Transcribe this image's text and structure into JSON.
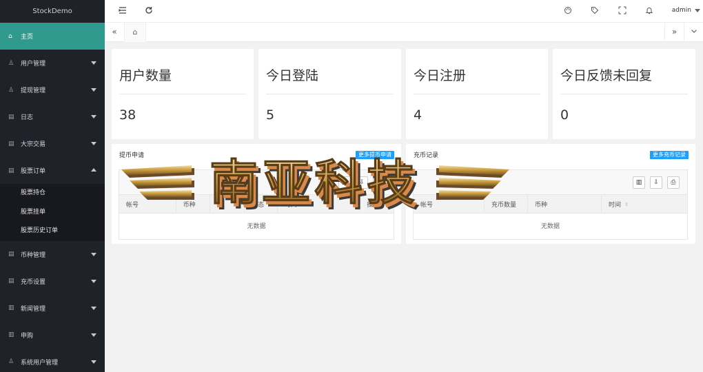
{
  "app": {
    "logo": "StockDemo"
  },
  "sidebar": {
    "items": [
      {
        "label": "主页",
        "icon": "home-icon",
        "active": true
      },
      {
        "label": "用户管理",
        "icon": "user-icon"
      },
      {
        "label": "提现管理",
        "icon": "user-icon"
      },
      {
        "label": "日志",
        "icon": "doc-icon"
      },
      {
        "label": "大宗交易",
        "icon": "doc-icon"
      },
      {
        "label": "股票订单",
        "icon": "doc-icon",
        "expanded": true
      },
      {
        "label": "币种管理",
        "icon": "doc-icon"
      },
      {
        "label": "充币设置",
        "icon": "doc-icon"
      },
      {
        "label": "新闻管理",
        "icon": "news-icon"
      },
      {
        "label": "申购",
        "icon": "news-icon"
      },
      {
        "label": "系统用户管理",
        "icon": "user-icon"
      }
    ],
    "stock_orders_sub": [
      {
        "label": "股票持仓"
      },
      {
        "label": "股票挂单"
      },
      {
        "label": "股票历史订单"
      }
    ]
  },
  "header": {
    "user": "admin"
  },
  "stats": [
    {
      "title": "用户数量",
      "value": "38"
    },
    {
      "title": "今日登陆",
      "value": "5"
    },
    {
      "title": "今日注册",
      "value": "4"
    },
    {
      "title": "今日反馈未回复",
      "value": "0"
    }
  ],
  "withdraw_panel": {
    "title": "提币申请",
    "link": "更多提币申请",
    "columns": [
      "帐号",
      "币种",
      "提",
      "状态",
      "时间",
      "操作"
    ],
    "empty": "无数据"
  },
  "recharge_panel": {
    "title": "充币记录",
    "link": "更多充币记录",
    "columns": [
      "帐号",
      "充币数量",
      "币种",
      "时间"
    ],
    "empty": "无数据"
  },
  "watermark": {
    "text": "南亚科技"
  },
  "colors": {
    "sidebar_bg": "#20222a",
    "active": "#2f9a8d",
    "link_blue": "#1e9fff"
  }
}
